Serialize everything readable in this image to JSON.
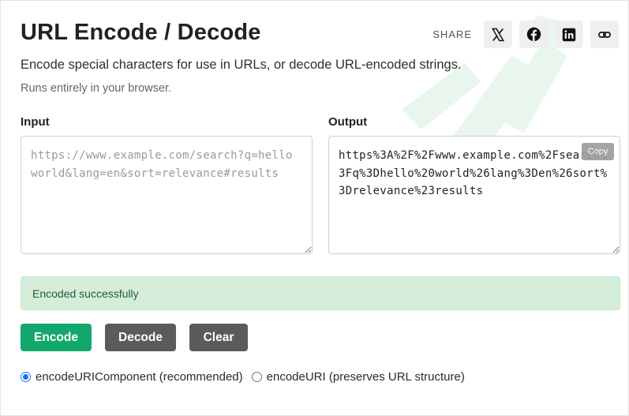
{
  "header": {
    "title": "URL Encode / Decode",
    "share_label": "SHARE",
    "share_buttons": [
      {
        "icon": "x-logo-icon"
      },
      {
        "icon": "facebook-icon"
      },
      {
        "icon": "linkedin-icon"
      },
      {
        "icon": "link-icon"
      }
    ]
  },
  "intro": {
    "subtitle": "Encode special characters for use in URLs, or decode URL-encoded strings.",
    "note": "Runs entirely in your browser."
  },
  "input": {
    "label": "Input",
    "value": "",
    "placeholder": "https://www.example.com/search?q=hello world&lang=en&sort=relevance#results"
  },
  "output": {
    "label": "Output",
    "value": "https%3A%2F%2Fwww.example.com%2Fsearch%3Fq%3Dhello%20world%26lang%3Den%26sort%3Drelevance%23results",
    "copy_label": "Copy"
  },
  "status": {
    "message": "Encoded successfully"
  },
  "actions": {
    "encode_label": "Encode",
    "decode_label": "Decode",
    "clear_label": "Clear"
  },
  "mode": {
    "options": [
      {
        "label": "encodeURIComponent (recommended)",
        "checked": true
      },
      {
        "label": "encodeURI (preserves URL structure)",
        "checked": false
      }
    ]
  },
  "colors": {
    "accent": "#13a86b",
    "secondary_button": "#5b5b5b",
    "success_bg": "#d4edda",
    "success_text": "#1f5f2e",
    "radio_checked": "#1a73e8"
  }
}
